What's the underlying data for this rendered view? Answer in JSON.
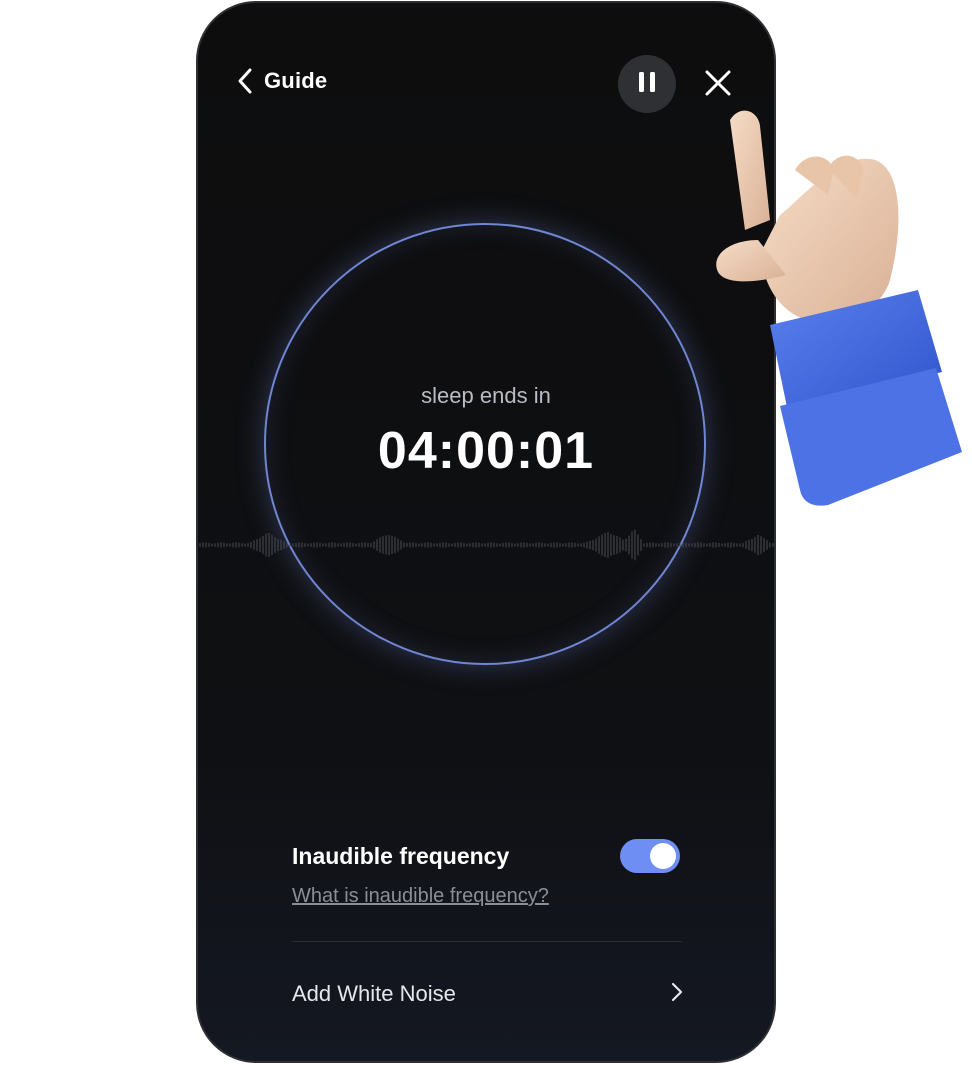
{
  "header": {
    "back_label": "Guide"
  },
  "timer": {
    "caption": "sleep ends in",
    "value": "04:00:01"
  },
  "settings": {
    "inaudible_frequency": {
      "title": "Inaudible frequency",
      "enabled": true,
      "help_link": "What is inaudible frequency?"
    },
    "white_noise": {
      "label": "Add White Noise"
    }
  },
  "icons": {
    "back": "chevron-left-icon",
    "pause": "pause-icon",
    "close": "close-icon",
    "row_arrow": "chevron-right-icon"
  },
  "colors": {
    "ring": "#7186d3",
    "toggle_on": "#6f8ef4",
    "sleeve": "#4a6fe0"
  }
}
